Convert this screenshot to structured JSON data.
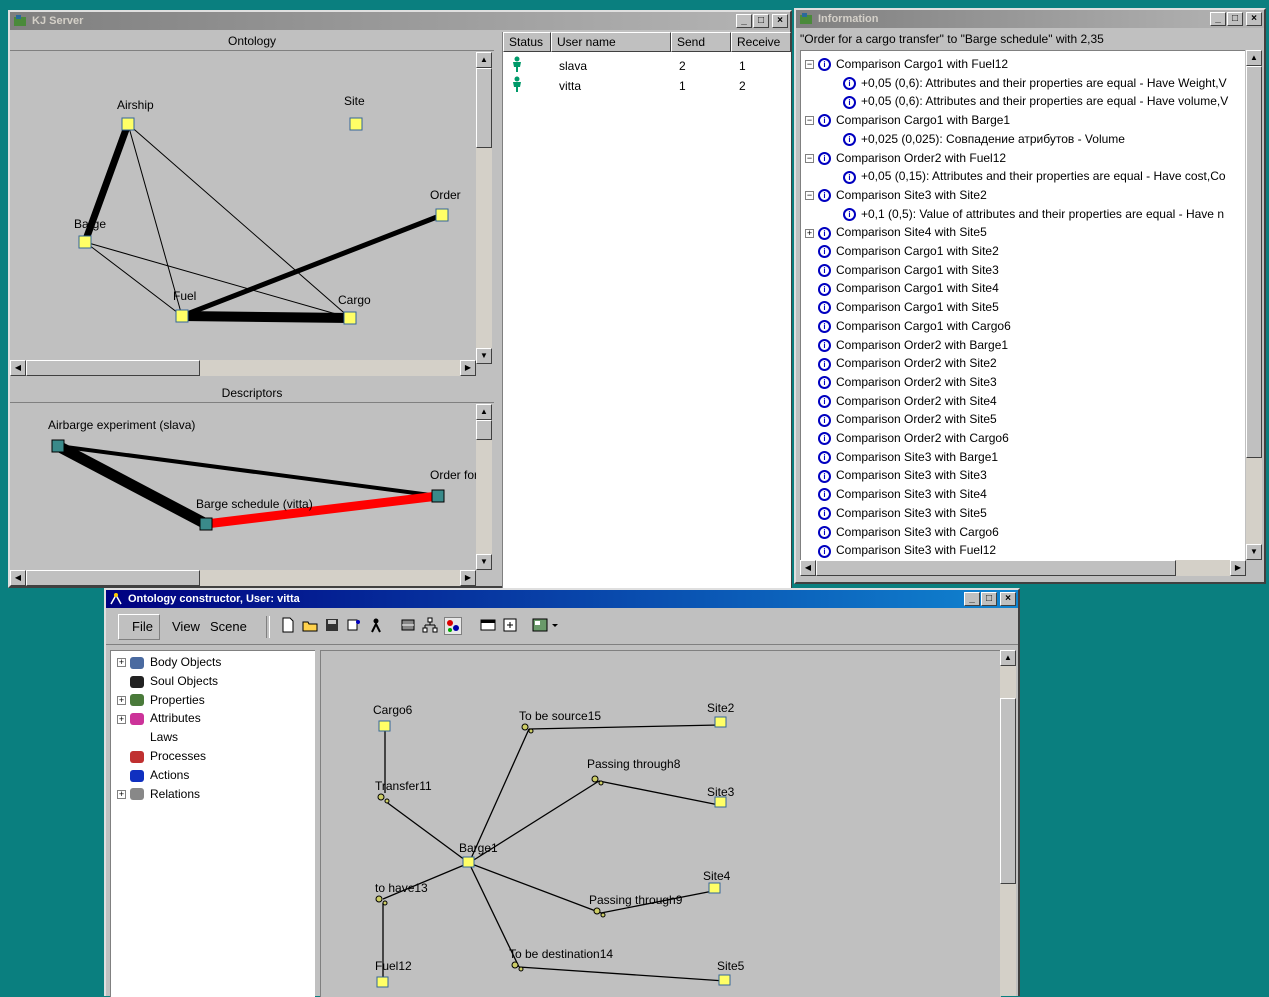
{
  "kj_server": {
    "title": "KJ Server",
    "ontology_caption": "Ontology",
    "descriptors_caption": "Descriptors",
    "ontology_nodes": [
      "Airship",
      "Site",
      "Order",
      "Barge",
      "Fuel",
      "Cargo"
    ],
    "descriptor_nodes": [
      "Airbarge experiment (slava)",
      "Order for",
      "Barge schedule (vitta)"
    ],
    "users_table": {
      "headers": [
        "Status",
        "User name",
        "Send",
        "Receive"
      ],
      "rows": [
        {
          "user": "slava",
          "send": "2",
          "receive": "1"
        },
        {
          "user": "vitta",
          "send": "1",
          "receive": "2"
        }
      ]
    }
  },
  "information": {
    "title": "Information",
    "header_text": "\"Order for a cargo transfer\" to \"Barge schedule\" with 2,35",
    "items": [
      {
        "level": 0,
        "expander": "-",
        "text": "Comparison Cargo1 with Fuel12"
      },
      {
        "level": 1,
        "expander": "",
        "text": "+0,05 (0,6): Attributes and their properties are equal - Have Weight,V"
      },
      {
        "level": 1,
        "expander": "",
        "text": "+0,05 (0,6): Attributes and their properties are equal - Have volume,V"
      },
      {
        "level": 0,
        "expander": "-",
        "text": "Comparison Cargo1 with Barge1"
      },
      {
        "level": 1,
        "expander": "",
        "text": "+0,025 (0,025): Совпадение атрибутов - Volume"
      },
      {
        "level": 0,
        "expander": "-",
        "text": "Comparison Order2 with Fuel12"
      },
      {
        "level": 1,
        "expander": "",
        "text": "+0,05 (0,15): Attributes and their properties are equal - Have cost,Co"
      },
      {
        "level": 0,
        "expander": "-",
        "text": "Comparison Site3 with Site2"
      },
      {
        "level": 1,
        "expander": "",
        "text": "+0,1 (0,5): Value of attributes and their properties are equal - Have n"
      },
      {
        "level": 0,
        "expander": "+",
        "text": "Comparison Site4 with Site5"
      },
      {
        "level": 0,
        "expander": "",
        "text": "Comparison Cargo1 with Site2"
      },
      {
        "level": 0,
        "expander": "",
        "text": "Comparison Cargo1 with Site3"
      },
      {
        "level": 0,
        "expander": "",
        "text": "Comparison Cargo1 with Site4"
      },
      {
        "level": 0,
        "expander": "",
        "text": "Comparison Cargo1 with Site5"
      },
      {
        "level": 0,
        "expander": "",
        "text": "Comparison Cargo1 with Cargo6"
      },
      {
        "level": 0,
        "expander": "",
        "text": "Comparison Order2 with Barge1"
      },
      {
        "level": 0,
        "expander": "",
        "text": "Comparison Order2 with Site2"
      },
      {
        "level": 0,
        "expander": "",
        "text": "Comparison Order2 with Site3"
      },
      {
        "level": 0,
        "expander": "",
        "text": "Comparison Order2 with Site4"
      },
      {
        "level": 0,
        "expander": "",
        "text": "Comparison Order2 with Site5"
      },
      {
        "level": 0,
        "expander": "",
        "text": "Comparison Order2 with Cargo6"
      },
      {
        "level": 0,
        "expander": "",
        "text": "Comparison Site3 with Barge1"
      },
      {
        "level": 0,
        "expander": "",
        "text": "Comparison Site3 with Site3"
      },
      {
        "level": 0,
        "expander": "",
        "text": "Comparison Site3 with Site4"
      },
      {
        "level": 0,
        "expander": "",
        "text": "Comparison Site3 with Site5"
      },
      {
        "level": 0,
        "expander": "",
        "text": "Comparison Site3 with Cargo6"
      },
      {
        "level": 0,
        "expander": "",
        "text": "Comparison Site3 with Fuel12"
      }
    ]
  },
  "constructor": {
    "title": "Ontology constructor, User: vitta",
    "menu": [
      "File",
      "View",
      "Scene"
    ],
    "tree": [
      {
        "expander": "+",
        "icon": "body-objects-icon",
        "label": "Body Objects"
      },
      {
        "expander": "",
        "icon": "soul-objects-icon",
        "label": "Soul Objects"
      },
      {
        "expander": "+",
        "icon": "properties-icon",
        "label": "Properties"
      },
      {
        "expander": "+",
        "icon": "attributes-icon",
        "label": "Attributes"
      },
      {
        "expander": "",
        "icon": "laws-icon",
        "label": "Laws"
      },
      {
        "expander": "",
        "icon": "processes-icon",
        "label": "Processes"
      },
      {
        "expander": "",
        "icon": "actions-icon",
        "label": "Actions"
      },
      {
        "expander": "+",
        "icon": "relations-icon",
        "label": "Relations"
      }
    ],
    "graph_labels": {
      "cargo6": "Cargo6",
      "transfer11": "Transfer11",
      "to_be_source15": "To be source15",
      "site2": "Site2",
      "passing9a": "Passing through8",
      "site3": "Site3",
      "barge1": "Barge1",
      "to_have13": "to have13",
      "site4": "Site4",
      "passing9b": "Passing through9",
      "fuel12": "Fuel12",
      "to_be_dest14": "To be destination14",
      "site5": "Site5"
    }
  },
  "colors": {
    "desktop": "#0a7f7f",
    "window": "#c0c0c0",
    "active_title": "#000080",
    "red_edge": "#ff0000",
    "info_icon": "#0000c0"
  }
}
